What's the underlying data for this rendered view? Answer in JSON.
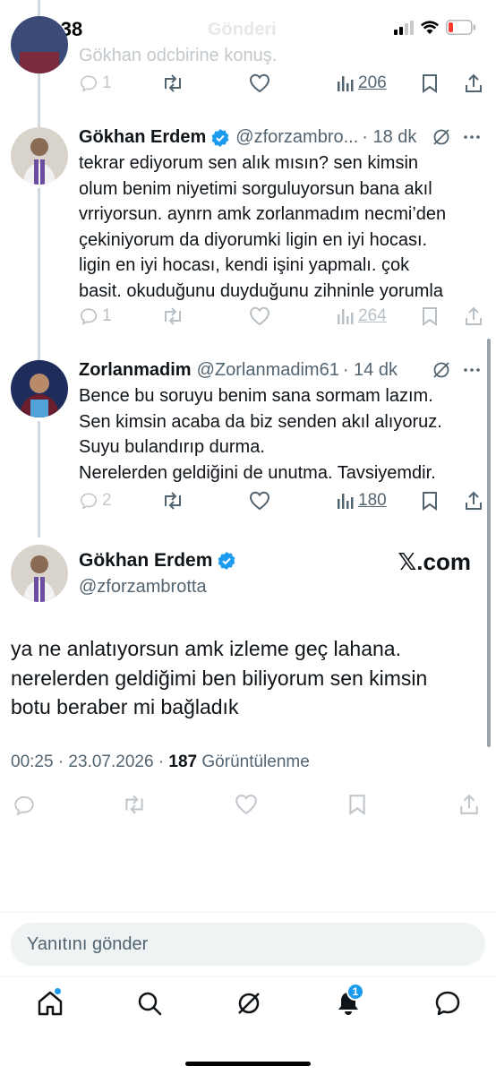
{
  "status_bar": {
    "time": "00:38",
    "ghost_title": "Gönderi"
  },
  "partial_tweet": {
    "text": "Gökhan odcbirine konuş.",
    "reply_count": "1",
    "views": "206"
  },
  "tweets": [
    {
      "display_name": "Gökhan Erdem",
      "handle": "@zforzambro...",
      "time_ago": "· 18 dk",
      "lines": [
        "tekrar ediyorum sen alık mısın? sen kimsin",
        "olum benim niyetimi sorguluyorsun bana akıl",
        "vrriyorsun. aynrn amk zorlanmadım necmi’den",
        "çekiniyorum da diyorumki ligin en iyi hocası.",
        "ligin en iyi hocası, kendi işini yapmalı. çok",
        "basit. okuduğunu duyduğunu zihninle yorumla"
      ],
      "reply_count": "1",
      "views": "264"
    },
    {
      "display_name": "Zorlanmadim",
      "handle": "@Zorlanmadim61",
      "time_ago": "· 14 dk",
      "lines": [
        "Bence bu soruyu benim sana sormam lazım.",
        "Sen kimsin acaba da biz senden akıl alıyoruz.",
        "Suyu bulandırıp durma.",
        "Nerelerden geldiğini de unutma. Tavsiyemdir."
      ],
      "reply_count": "2",
      "views": "180"
    }
  ],
  "main_tweet": {
    "display_name": "Gökhan Erdem",
    "handle": "@zforzambrotta",
    "source_badge": "𝕏.com",
    "lines": [
      "ya ne anlatıyorsun amk izleme geç lahana.",
      "nerelerden geldiğimi ben biliyorum sen kimsin",
      "botu beraber mi bağladık"
    ],
    "timestamp": "00:25 · 23.07.2026 · ",
    "views_count": "187",
    "views_label": " Görüntülenme"
  },
  "reply_box": {
    "placeholder": "Yanıtını gönder"
  },
  "tab_bar": {
    "notification_count": "1"
  },
  "colors": {
    "accent": "#1d9bf0",
    "text": "#0f1419",
    "secondary": "#536471",
    "battery": "#ff3b30",
    "avatar_bg": "#6b4ea0"
  },
  "icons": [
    "reply-icon",
    "retweet-icon",
    "like-icon",
    "views-icon",
    "bookmark-icon",
    "share-icon",
    "grok-icon",
    "more-icon",
    "verified-icon",
    "home-icon",
    "search-icon",
    "notifications-icon",
    "messages-icon"
  ]
}
